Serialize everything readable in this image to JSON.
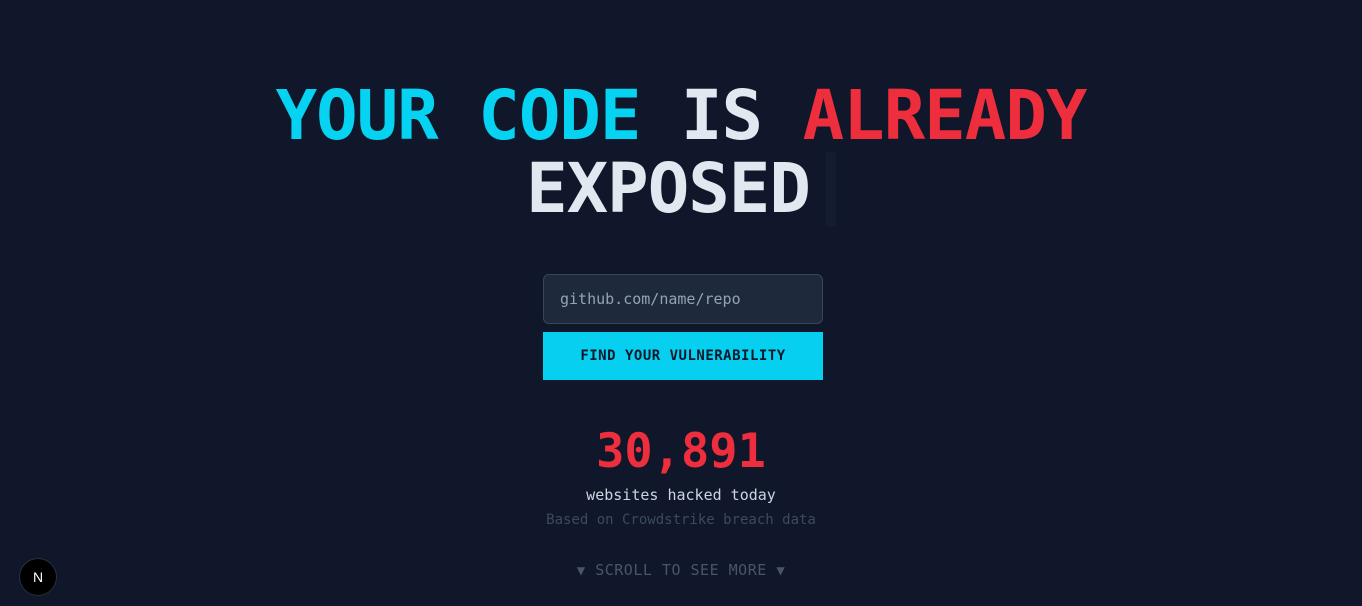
{
  "headline": {
    "line1": [
      {
        "text": "YOUR",
        "tone": "cyan"
      },
      {
        "text": "CODE",
        "tone": "cyan"
      },
      {
        "text": "IS",
        "tone": "white"
      },
      {
        "text": "ALREADY",
        "tone": "red"
      }
    ],
    "line2": "EXPOSED"
  },
  "form": {
    "repo_placeholder": "github.com/name/repo",
    "repo_value": "",
    "submit_label": "FIND YOUR VULNERABILITY"
  },
  "stats": {
    "count": "30,891",
    "label": "websites hacked today",
    "source": "Based on Crowdstrike breach data"
  },
  "scroll_hint": {
    "arrow": "▼",
    "label": "SCROLL TO SEE MORE"
  },
  "dev_badge": {
    "letter": "N",
    "icon": "nextjs-icon"
  },
  "colors": {
    "background": "#10172a",
    "accent_cyan": "#06d3f2",
    "accent_red": "#ee2e3c",
    "text": "#e2e8f0"
  }
}
